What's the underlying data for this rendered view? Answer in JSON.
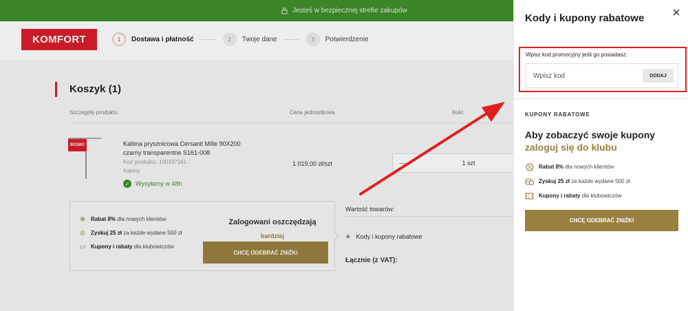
{
  "topbar": {
    "secure_text": "Jesteś w bezpiecznej strefie zakupów"
  },
  "header": {
    "logo_text": "KOMFORT",
    "steps": [
      {
        "number": "1",
        "label": "Dostawa i płatność"
      },
      {
        "number": "2",
        "label": "Twoje dane"
      },
      {
        "number": "3",
        "label": "Potwierdzenie"
      }
    ]
  },
  "cart": {
    "title": "Koszyk (1)",
    "columns": {
      "details": "Szczegóły produktu",
      "unit_price": "Cena jednostkowa",
      "quantity": "Ilość"
    },
    "product": {
      "badge": "BOSKI!",
      "name": "Kabina prysznicowa Cersanit Mille 90X200 czarny transparentne S161-008",
      "code": "Kod produktu: 100337161",
      "category": "Kabiny",
      "shipping": "Wysyłamy w 48h",
      "unit_price": "1 019,00 zł/szt",
      "qty_minus": "—",
      "qty_value": "1 szt"
    },
    "perks": [
      {
        "bold": "Rabat 8%",
        "text": " dla nowych klientów"
      },
      {
        "bold": "Zyskuj 25 zł",
        "text": " za każde wydane 500 zł"
      },
      {
        "bold": "Kupony i rabaty",
        "text": " dla klubowiczów"
      }
    ],
    "club_title": "Zalogowani oszczędzają",
    "club_subtitle": "bardziej",
    "club_button": "CHCĘ ODEBRAĆ ZNIŻKI",
    "summary": {
      "goods_value": "Wartość towarów:",
      "codes_link": "Kody i kupony rabatowe",
      "total": "Łącznie (z VAT):"
    }
  },
  "panel": {
    "title": "Kody i kupony rabatowe",
    "code_label": "Wpisz kod promocyjny jeśli go posiadasz:",
    "code_placeholder": "Wpisz kod",
    "add_button": "DODAJ",
    "coupons_heading": "KUPONY RABATOWE",
    "coupons_title": "Aby zobaczyć swoje kupony",
    "coupons_login": "zaloguj się do klubu",
    "perks": [
      {
        "bold": "Rabat 8%",
        "text": " dla nowych klientów"
      },
      {
        "bold": "Zyskuj 25 zł",
        "text": " za każde wydane 500 zł"
      },
      {
        "bold": "Kupony i rabaty",
        "text": " dla klubowiczów"
      }
    ],
    "button": "CHCĘ ODEBRAĆ ZNIŻKI"
  },
  "colors": {
    "green": "#3f8f2e",
    "brand_red": "#d81e2a",
    "gold": "#9a8040",
    "annotation_red": "#e02020"
  }
}
